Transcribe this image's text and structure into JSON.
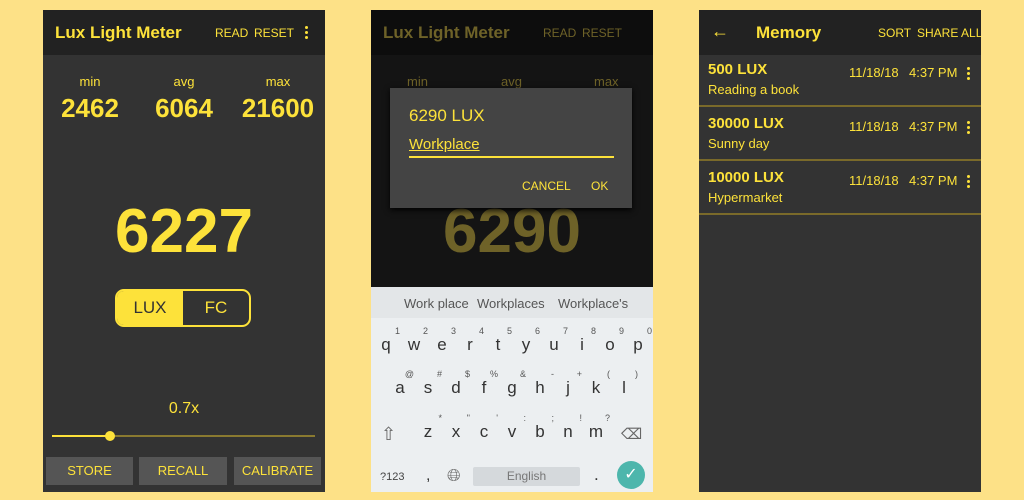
{
  "colors": {
    "background": "#fde187",
    "panel": "#333333",
    "topbar": "#222222",
    "accent": "#fde23a",
    "keyboard": "#eceff1",
    "ok_button": "#4db6ac"
  },
  "meter": {
    "title": "Lux Light Meter",
    "read": "READ",
    "reset": "RESET",
    "menu_icon": "more-vert-icon",
    "stats": [
      {
        "label": "min",
        "value": "2462"
      },
      {
        "label": "avg",
        "value": "6064"
      },
      {
        "label": "max",
        "value": "21600"
      }
    ],
    "reading": "6227",
    "units": [
      {
        "label": "LUX",
        "selected": true
      },
      {
        "label": "FC",
        "selected": false
      }
    ],
    "multiplier": "0.7x",
    "slider_fraction": 0.22,
    "buttons": [
      "STORE",
      "RECALL",
      "CALIBRATE"
    ]
  },
  "dialog_screen": {
    "title": "Lux Light Meter",
    "read": "READ",
    "reset": "RESET",
    "stats": [
      "min",
      "avg",
      "max"
    ],
    "reading": "6290",
    "dialog": {
      "title": "6290 LUX",
      "input_value": "Workplace",
      "cancel": "CANCEL",
      "ok": "OK"
    },
    "keyboard": {
      "suggestions": [
        "Work place",
        "Workplaces",
        "Workplace's"
      ],
      "rows": [
        [
          [
            "q",
            "1"
          ],
          [
            "w",
            "2"
          ],
          [
            "e",
            "3"
          ],
          [
            "r",
            "4"
          ],
          [
            "t",
            "5"
          ],
          [
            "y",
            "6"
          ],
          [
            "u",
            "7"
          ],
          [
            "i",
            "8"
          ],
          [
            "o",
            "9"
          ],
          [
            "p",
            "0"
          ]
        ],
        [
          [
            "a",
            "@"
          ],
          [
            "s",
            "#"
          ],
          [
            "d",
            "$"
          ],
          [
            "f",
            "%"
          ],
          [
            "g",
            "&"
          ],
          [
            "h",
            "-"
          ],
          [
            "j",
            "+"
          ],
          [
            "k",
            "("
          ],
          [
            "l",
            ")"
          ]
        ],
        [
          [
            "z",
            "*"
          ],
          [
            "x",
            "\""
          ],
          [
            "c",
            "'"
          ],
          [
            "v",
            ":"
          ],
          [
            "b",
            ";"
          ],
          [
            "n",
            "!"
          ],
          [
            "m",
            "?"
          ]
        ]
      ],
      "symbols": "?123",
      "comma": ",",
      "space": "English",
      "period": "."
    }
  },
  "memory": {
    "title": "Memory",
    "sort": "SORT",
    "share_all": "SHARE ALL",
    "items": [
      {
        "value": "500 LUX",
        "note": "Reading a book",
        "date": "11/18/18",
        "time": "4:37 PM"
      },
      {
        "value": "30000 LUX",
        "note": "Sunny day",
        "date": "11/18/18",
        "time": "4:37 PM"
      },
      {
        "value": "10000 LUX",
        "note": "Hypermarket",
        "date": "11/18/18",
        "time": "4:37 PM"
      }
    ]
  }
}
